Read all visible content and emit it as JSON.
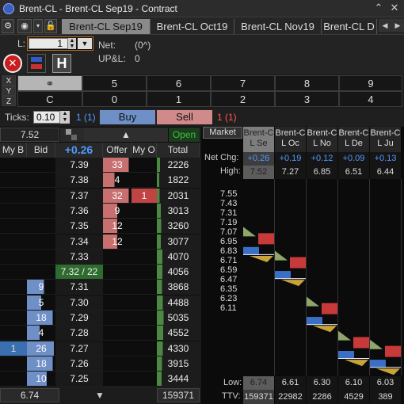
{
  "window": {
    "title": "Brent-CL - Brent-CL Sep19 - Contract"
  },
  "tabs": [
    "Brent-CL Sep19",
    "Brent-CL Oct19",
    "Brent-CL Nov19",
    "Brent-CL D"
  ],
  "order": {
    "l_label": "L:",
    "qty": "1",
    "net_label": "Net:",
    "net_value": "(0^)",
    "upl_label": "UP&L:",
    "upl_value": "0",
    "h_label": "H"
  },
  "qgrid": {
    "row_x": [
      "X",
      "Y",
      "Z"
    ],
    "top": [
      "5",
      "6",
      "7",
      "8",
      "9"
    ],
    "bottom_first": "C",
    "bottom": [
      "0",
      "1",
      "2",
      "3",
      "4"
    ]
  },
  "ticks": {
    "label": "Ticks:",
    "value": "0.10",
    "buy_count": "1 (1)",
    "buy": "Buy",
    "sell": "Sell",
    "sell_count": "1 (1)"
  },
  "dom": {
    "last": "7.52",
    "status": "Open",
    "headers": [
      "My B",
      "Bid",
      "+0.26",
      "Offer",
      "My O",
      "Total"
    ],
    "footer_price": "6.74",
    "footer_total": "159371",
    "rows": [
      {
        "mb": "",
        "bid": "",
        "price": "7.39",
        "offer": "33",
        "mo": "",
        "total": "2226",
        "bw": 0,
        "ow": 0.9,
        "tw": 0.35
      },
      {
        "mb": "",
        "bid": "",
        "price": "7.38",
        "offer": "4",
        "mo": "",
        "total": "1822",
        "bw": 0,
        "ow": 0.4,
        "tw": 0.3
      },
      {
        "mb": "",
        "bid": "",
        "price": "7.37",
        "offer": "32",
        "mo": "1",
        "total": "2031",
        "bw": 0,
        "ow": 0.9,
        "tw": 0.33
      },
      {
        "mb": "",
        "bid": "",
        "price": "7.36",
        "offer": "9",
        "mo": "",
        "total": "3013",
        "bw": 0,
        "ow": 0.5,
        "tw": 0.45
      },
      {
        "mb": "",
        "bid": "",
        "price": "7.35",
        "offer": "12",
        "mo": "",
        "total": "3260",
        "bw": 0,
        "ow": 0.5,
        "tw": 0.5
      },
      {
        "mb": "",
        "bid": "",
        "price": "7.34",
        "offer": "12",
        "mo": "",
        "total": "3077",
        "bw": 0,
        "ow": 0.5,
        "tw": 0.47
      },
      {
        "mb": "",
        "bid": "",
        "price": "7.33",
        "offer": "",
        "mo": "",
        "total": "4070",
        "bw": 0,
        "ow": 0,
        "tw": 0.65
      },
      {
        "mb": "",
        "bid": "",
        "price": "7.32 / 22",
        "offer": "",
        "mo": "",
        "total": "4056",
        "bw": 0,
        "ow": 0,
        "tw": 0.65
      },
      {
        "mb": "",
        "bid": "9",
        "price": "7.31",
        "offer": "",
        "mo": "",
        "total": "3868",
        "bw": 0.6,
        "ow": 0,
        "tw": 0.6
      },
      {
        "mb": "",
        "bid": "5",
        "price": "7.30",
        "offer": "",
        "mo": "",
        "total": "4488",
        "bw": 0.5,
        "ow": 0,
        "tw": 0.7
      },
      {
        "mb": "",
        "bid": "18",
        "price": "7.29",
        "offer": "",
        "mo": "",
        "total": "5035",
        "bw": 0.9,
        "ow": 0,
        "tw": 0.8
      },
      {
        "mb": "",
        "bid": "4",
        "price": "7.28",
        "offer": "",
        "mo": "",
        "total": "4552",
        "bw": 0.45,
        "ow": 0,
        "tw": 0.72
      },
      {
        "mb": "1",
        "bid": "26",
        "price": "7.27",
        "offer": "",
        "mo": "",
        "total": "4330",
        "bw": 0.95,
        "ow": 0,
        "tw": 0.7
      },
      {
        "mb": "",
        "bid": "18",
        "price": "7.26",
        "offer": "",
        "mo": "",
        "total": "3915",
        "bw": 0.9,
        "ow": 0,
        "tw": 0.62
      },
      {
        "mb": "",
        "bid": "10",
        "price": "7.25",
        "offer": "",
        "mo": "",
        "total": "3444",
        "bw": 0.7,
        "ow": 0,
        "tw": 0.55
      }
    ]
  },
  "market": {
    "label": "Market",
    "netchg_label": "Net Chg:",
    "high_label": "High:",
    "low_label": "Low:",
    "ttv_label": "TTV:",
    "contracts": [
      {
        "name": "Brent-CL Se",
        "netchg": "+0.26",
        "high": "7.52",
        "low": "6.74",
        "ttv": "159371"
      },
      {
        "name": "Brent-CL Oc",
        "netchg": "+0.19",
        "high": "7.27",
        "low": "6.61",
        "ttv": "22982"
      },
      {
        "name": "Brent-CL No",
        "netchg": "+0.12",
        "high": "6.85",
        "low": "6.30",
        "ttv": "2286"
      },
      {
        "name": "Brent-CL De",
        "netchg": "+0.09",
        "high": "6.51",
        "low": "6.10",
        "ttv": "4529"
      },
      {
        "name": "Brent-CL Ju",
        "netchg": "+0.13",
        "high": "6.44",
        "low": "6.03",
        "ttv": "389"
      }
    ],
    "price_ticks": [
      "7.55",
      "7.43",
      "7.31",
      "7.19",
      "7.07",
      "6.95",
      "6.83",
      "6.71",
      "6.59",
      "6.47",
      "6.35",
      "6.23",
      "6.11"
    ]
  },
  "colors": {
    "bid": "#4d7fbf",
    "offer": "#c84b4b",
    "total": "#3d7a3b",
    "green_text": "#3ec43e",
    "blue_text": "#4f9bff",
    "red_text": "#ff5555"
  }
}
